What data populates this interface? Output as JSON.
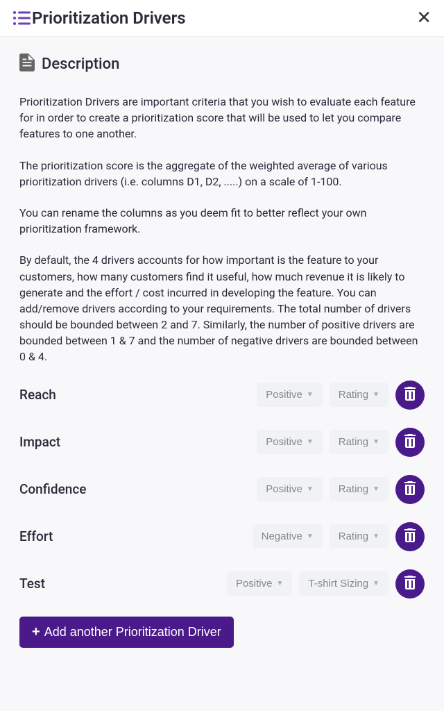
{
  "header": {
    "title": "Prioritization Drivers"
  },
  "section": {
    "title": "Description"
  },
  "description": {
    "p1": "Prioritization Drivers are important criteria that you wish to evaluate each feature for in order to create a prioritization score that will be used to let you compare features to one another.",
    "p2": "The prioritization score is the aggregate of the weighted average of various prioritization drivers (i.e. columns D1, D2, .....) on a scale of 1-100.",
    "p3": "You can rename the columns as you deem fit to better reflect your own prioritization framework.",
    "p4": "By default, the 4 drivers accounts for how important is the feature to your customers, how many customers find it useful, how much revenue it is likely to generate and the effort / cost incurred in developing the feature. You can add/remove drivers according to your requirements. The total number of drivers should be bounded between 2 and 7. Similarly, the number of positive drivers are bounded between 1 & 7 and the number of negative drivers are bounded between 0 & 4."
  },
  "drivers": [
    {
      "name": "Reach",
      "polarity": "Positive",
      "scale": "Rating"
    },
    {
      "name": "Impact",
      "polarity": "Positive",
      "scale": "Rating"
    },
    {
      "name": "Confidence",
      "polarity": "Positive",
      "scale": "Rating"
    },
    {
      "name": "Effort",
      "polarity": "Negative",
      "scale": "Rating"
    },
    {
      "name": "Test",
      "polarity": "Positive",
      "scale": "T-shirt Sizing"
    }
  ],
  "addButton": {
    "label": "Add another Prioritization Driver"
  },
  "colors": {
    "accent": "#4a1a8a"
  }
}
